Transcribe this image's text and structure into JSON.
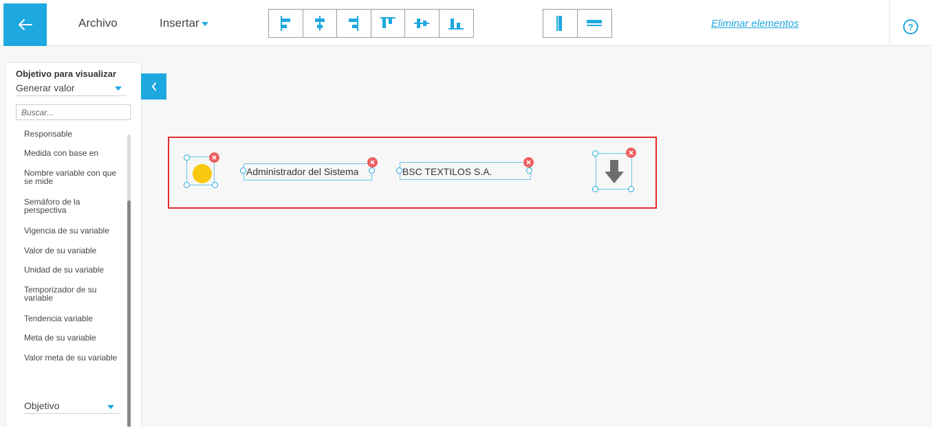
{
  "topbar": {
    "file_menu": "Archivo",
    "insert_menu": "Insertar",
    "remove_elements": "Eliminar elementos",
    "help_symbol": "?",
    "accent_color": "#1ea8e0",
    "align_tools": [
      "align-left-icon",
      "align-center-horizontal-icon",
      "align-right-icon",
      "align-top-icon",
      "align-middle-vertical-icon",
      "align-bottom-icon"
    ],
    "size_tools": [
      "same-height-icon",
      "same-width-icon"
    ]
  },
  "sidebar": {
    "title": "Objetivo para visualizar",
    "selected_option": "Generar valor",
    "search_placeholder": "Buscar...",
    "items": [
      "Responsable",
      "Medida con base en",
      "Nombre variable con que se mide",
      "Semáforo de la perspectiva",
      "Vigencia de su variable",
      "Valor de su variable",
      "Unidad de su variable",
      "Temporizador de su variable",
      "Tendencia variable",
      "Meta de su variable",
      "Valor meta de su variable"
    ],
    "section_select": "Objetivo"
  },
  "canvas": {
    "border_color": "#e22b2b",
    "semaphore_color": "#f9c80e",
    "responsible_text": "Administrador del Sistema",
    "company_text": "BSC TEXTILOS S.A.",
    "trend_icon": "arrow-down-icon",
    "delete_color": "#ee5f5f"
  }
}
